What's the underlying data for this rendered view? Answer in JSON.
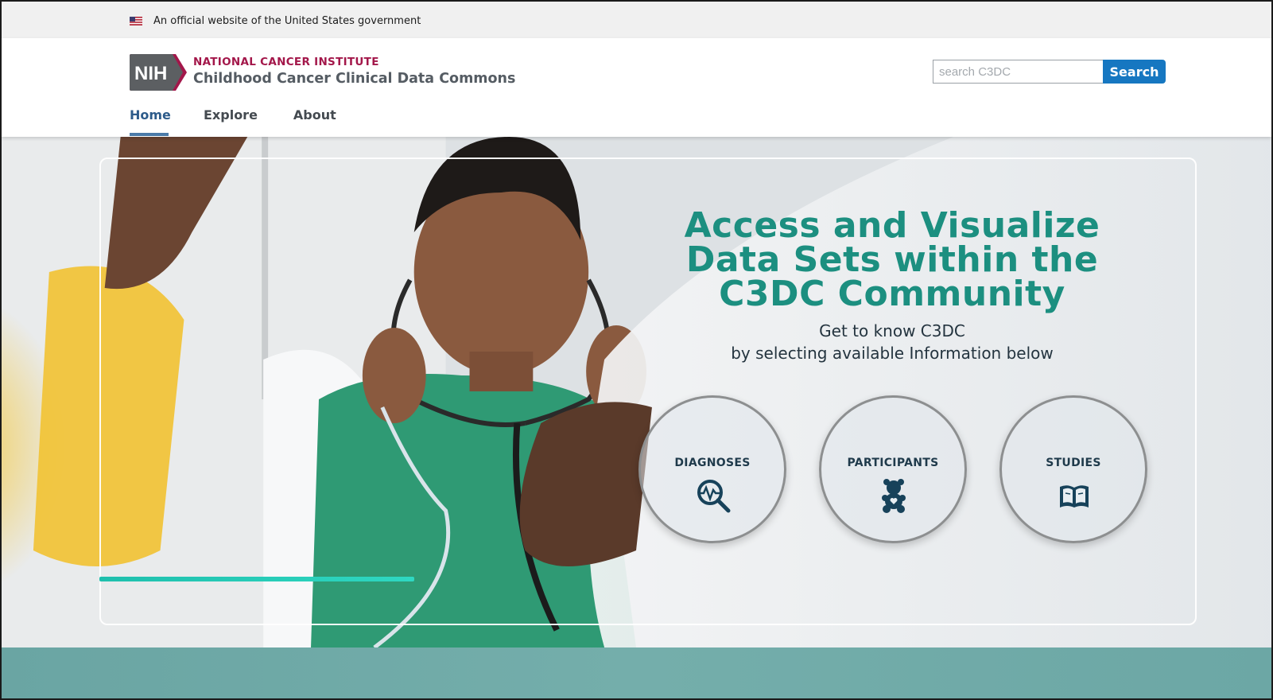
{
  "gov_banner": {
    "text": "An official website of the United States government"
  },
  "header": {
    "logo_text": "NIH",
    "institute": "NATIONAL CANCER INSTITUTE",
    "site_title": "Childhood Cancer Clinical Data Commons"
  },
  "search": {
    "placeholder": "search C3DC",
    "value": "",
    "button_label": "Search"
  },
  "nav": {
    "items": [
      {
        "label": "Home",
        "active": true
      },
      {
        "label": "Explore",
        "active": false
      },
      {
        "label": "About",
        "active": false
      }
    ]
  },
  "hero": {
    "headline_line1": "Access and Visualize",
    "headline_line2": "Data Sets within the",
    "headline_line3": "C3DC Community",
    "sub_line1": "Get to know C3DC",
    "sub_line2": "by selecting available Information below",
    "cards": [
      {
        "label": "DIAGNOSES",
        "icon": "magnifier-pulse-icon"
      },
      {
        "label": "PARTICIPANTS",
        "icon": "teddy-bear-icon"
      },
      {
        "label": "STUDIES",
        "icon": "open-book-icon"
      }
    ]
  },
  "colors": {
    "accent_teal": "#1c8f80",
    "nci_red": "#a3174a",
    "search_blue": "#1677c1",
    "nav_active": "#2d5b8a",
    "bottom_band": "#6aa5a3"
  }
}
